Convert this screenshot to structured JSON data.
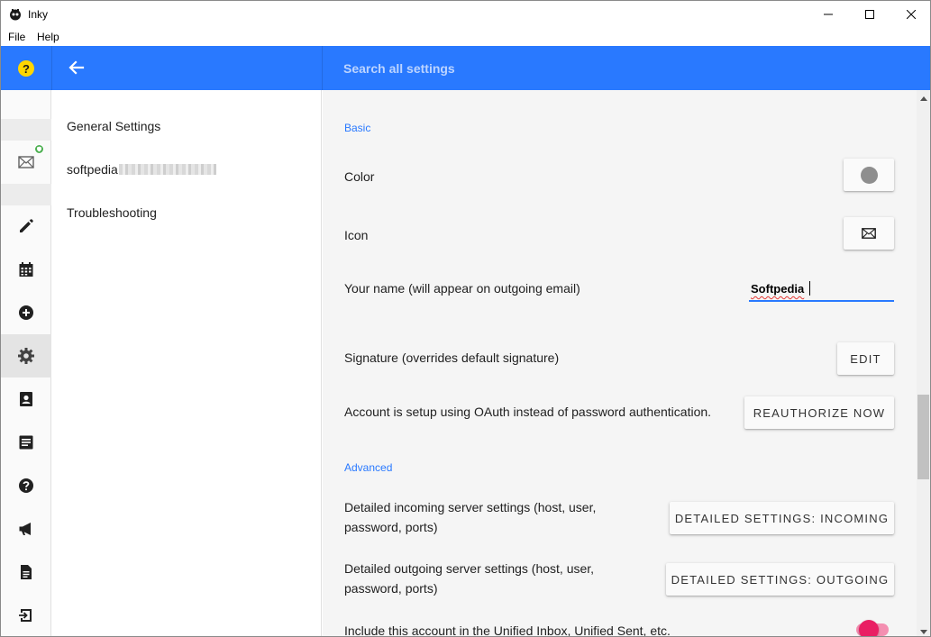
{
  "window": {
    "title": "Inky"
  },
  "menubar": {
    "items": [
      "File",
      "Help"
    ]
  },
  "header": {
    "help_badge": "?",
    "search_placeholder": "Search all settings"
  },
  "rail": {
    "items": [
      {
        "icon": "mail-icon",
        "badge": "shield-icon"
      },
      {
        "icon": "pencil-icon"
      },
      {
        "icon": "calendar-icon"
      },
      {
        "icon": "plus-circle-icon"
      },
      {
        "icon": "gear-icon",
        "active": true
      },
      {
        "icon": "contacts-icon"
      },
      {
        "icon": "notes-icon"
      },
      {
        "icon": "help-icon"
      },
      {
        "icon": "megaphone-icon"
      },
      {
        "icon": "document-icon"
      },
      {
        "icon": "logout-icon"
      }
    ]
  },
  "nav": {
    "items": [
      {
        "label": "General Settings"
      },
      {
        "label": "softpedia"
      },
      {
        "label": "Troubleshooting"
      }
    ]
  },
  "settings": {
    "basic_title": "Basic",
    "color_label": "Color",
    "icon_label": "Icon",
    "name_label": "Your name (will appear on outgoing email)",
    "name_value": "Softpedia",
    "signature_label": "Signature (overrides default signature)",
    "signature_button": "EDIT",
    "oauth_label": "Account is setup using OAuth instead of password authentication.",
    "oauth_button": "REAUTHORIZE NOW",
    "advanced_title": "Advanced",
    "incoming_label_1": "Detailed incoming server settings (host, user,",
    "incoming_label_2": "password, ports)",
    "incoming_button": "DETAILED SETTINGS: INCOMING",
    "outgoing_label_1": "Detailed outgoing server settings (host, user,",
    "outgoing_label_2": "password, ports)",
    "outgoing_button": "DETAILED SETTINGS: OUTGOING",
    "unified_label": "Include this account in the Unified Inbox, Unified Sent, etc.",
    "unified_enabled": true
  },
  "colors": {
    "accent": "#2979ff",
    "help_badge": "#ffd600",
    "toggle": "#e91e63",
    "swatch": "#8e8e8e"
  }
}
